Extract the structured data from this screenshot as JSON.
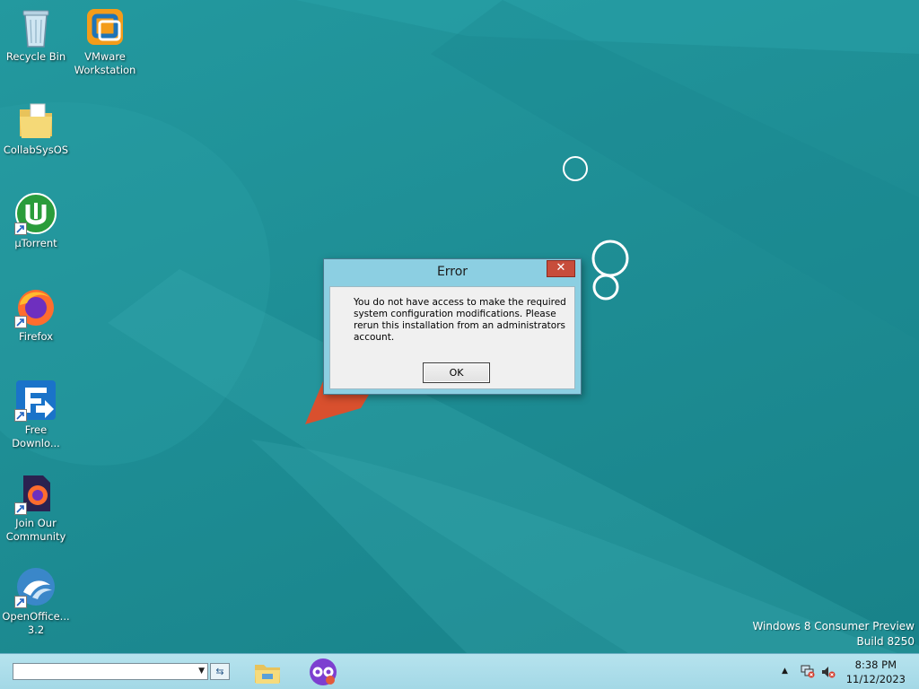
{
  "desktop": {
    "icons": [
      {
        "label": "Recycle Bin",
        "icon": "recycle-bin-icon"
      },
      {
        "label": "VMware Workstation",
        "icon": "vmware-icon"
      },
      {
        "label": "CollabSysOS",
        "icon": "folder-icon"
      },
      {
        "label": "µTorrent",
        "icon": "utorrent-icon"
      },
      {
        "label": "Firefox",
        "icon": "firefox-icon"
      },
      {
        "label": "Free Downlo...",
        "icon": "free-download-manager-icon"
      },
      {
        "label": "Join Our Community",
        "icon": "community-firefox-icon"
      },
      {
        "label": "OpenOffice... 3.2",
        "icon": "openoffice-icon"
      }
    ],
    "watermark": {
      "line1": "Windows 8 Consumer Preview",
      "line2": "Build 8250"
    }
  },
  "dialog": {
    "title": "Error",
    "close_glyph": "✕",
    "message": "You do not have access to make the required system configuration modifications. Please rerun this installation from an administrators account.",
    "ok_label": "OK"
  },
  "taskbar": {
    "address_value": "",
    "go_glyph": "⇆",
    "pinned": [
      {
        "name": "file-explorer-icon"
      },
      {
        "name": "tor-browser-icon"
      }
    ],
    "tray": {
      "chevron": "▲",
      "network_icon": "network-error-icon",
      "volume_icon": "volume-muted-icon"
    },
    "clock": {
      "time": "8:38 PM",
      "date": "11/12/2023"
    }
  },
  "colors": {
    "desktop_bg": "#1f8f95",
    "dialog_frame": "#8ccfe2",
    "taskbar_bg": "#a8dae8",
    "close_button": "#c74d3b",
    "accent_orange": "#d9502e"
  }
}
